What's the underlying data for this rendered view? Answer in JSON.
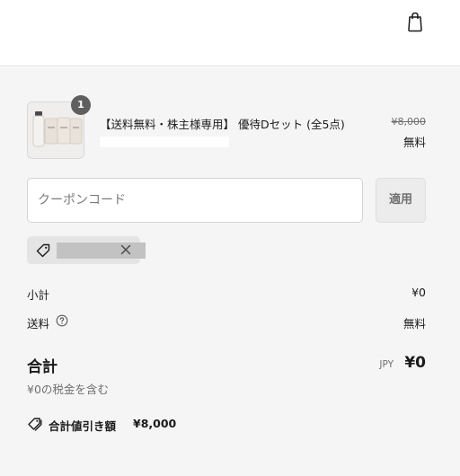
{
  "header": {
    "cart_icon": "shopping-bag-icon"
  },
  "product": {
    "quantity": "1",
    "title": "【送料無料・株主様専用】 優待Dセット (全5点)",
    "original_price": "¥8,000",
    "price": "無料"
  },
  "coupon": {
    "placeholder": "クーポンコード",
    "apply_label": "適用",
    "applied_code": "",
    "tag_icon": "tag-icon",
    "remove_icon": "close-icon"
  },
  "summary": {
    "subtotal_label": "小計",
    "subtotal_value": "¥0",
    "shipping_label": "送料",
    "shipping_value": "無料",
    "help_icon": "help-circle-icon",
    "total_label": "合計",
    "currency": "JPY",
    "total_value": "¥0",
    "tax_note": "¥0の税金を含む"
  },
  "savings": {
    "icon": "tags-icon",
    "label": "合計値引き額",
    "value": "¥8,000"
  },
  "colors": {
    "summary_background": "#f5f5f5",
    "badge": "#5f5f5f",
    "muted_text": "#707070",
    "text": "#1a1a1a"
  }
}
